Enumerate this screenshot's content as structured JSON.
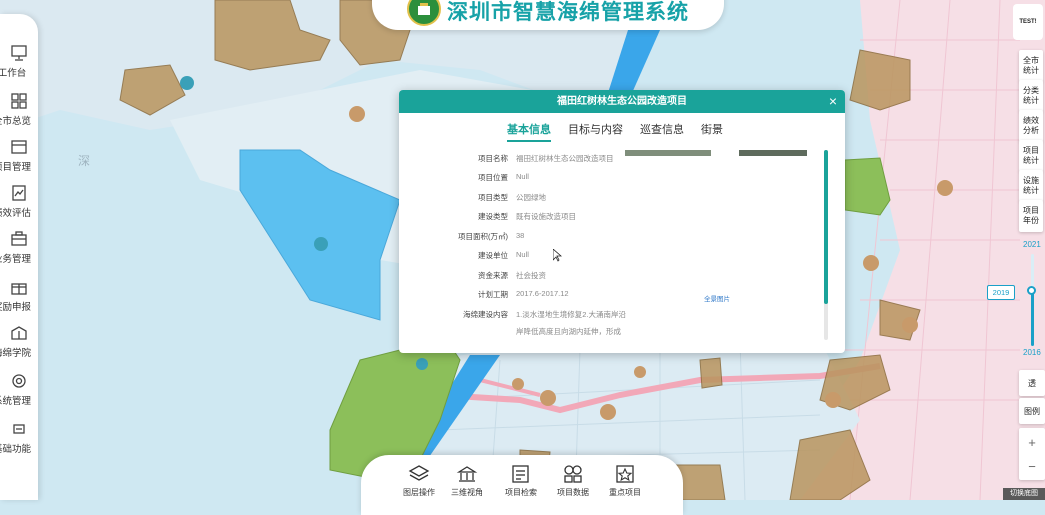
{
  "app": {
    "title": "深圳市智慧海绵管理系统"
  },
  "sidebar": {
    "items": [
      {
        "label": "工作台",
        "icon": "monitor-icon"
      },
      {
        "label": "全市总览",
        "icon": "grid-icon"
      },
      {
        "label": "项目管理",
        "icon": "folder-icon"
      },
      {
        "label": "绩效评估",
        "icon": "chart-icon"
      },
      {
        "label": "业务管理",
        "icon": "briefcase-icon"
      },
      {
        "label": "奖励申报",
        "icon": "gift-icon"
      },
      {
        "label": "海绵学院",
        "icon": "book-icon"
      },
      {
        "label": "系统管理",
        "icon": "gear-icon"
      },
      {
        "label": "基础功能",
        "icon": "box-icon"
      }
    ]
  },
  "right_stats": [
    {
      "label": "全市\n统计"
    },
    {
      "label": "分类\n统计"
    },
    {
      "label": "绩效\n分析"
    },
    {
      "label": "项目\n统计"
    },
    {
      "label": "设施\n统计"
    },
    {
      "label": "项目\n年份"
    }
  ],
  "year_slider": {
    "max": "2021",
    "min": "2016",
    "current": "2019",
    "position": 0.6
  },
  "map_controls": {
    "transparent": "透",
    "legend": "图例",
    "zoom_in": "+",
    "zoom_out": "−"
  },
  "map_labels": [
    {
      "text": "深"
    },
    {
      "text": "TEST!"
    }
  ],
  "panel": {
    "title": "福田红树林生态公园改造项目",
    "close": "×",
    "tabs": [
      "基本信息",
      "目标与内容",
      "巡查信息",
      "街景"
    ],
    "active_tab": 0,
    "rows": [
      {
        "label": "项目名称",
        "value": "福田红树林生态公园改造项目"
      },
      {
        "label": "项目位置",
        "value": "Null"
      },
      {
        "label": "项目类型",
        "value": "公园绿地"
      },
      {
        "label": "建设类型",
        "value": "既有设施改造项目"
      },
      {
        "label": "项目面积(万㎡)",
        "value": "38"
      },
      {
        "label": "建设单位",
        "value": "Null"
      },
      {
        "label": "资金来源",
        "value": "社会投资"
      },
      {
        "label": "计划工期",
        "value": "2017.6-2017.12"
      },
      {
        "label": "海绵建设内容",
        "value": "1.淡水湿地生境修复2.大涌南岸沿"
      },
      {
        "label": "",
        "value": "岸降低高度且向湖内延伸，形成"
      }
    ],
    "all_photos": "全景图片"
  },
  "bottom_bar": {
    "items": [
      {
        "label": "图层操作",
        "icon": "layers-icon"
      },
      {
        "label": "三维视角",
        "icon": "building-icon"
      },
      {
        "label": "项目检索",
        "icon": "list-icon"
      },
      {
        "label": "项目数据",
        "icon": "data-icon"
      },
      {
        "label": "重点项目",
        "icon": "star-icon"
      }
    ]
  },
  "bottom_right": {
    "label": "切换底图"
  },
  "colors": {
    "accent": "#1aa39a",
    "title": "#17a2a8",
    "water": "#cfe8f2",
    "project_fill": "#b9955e",
    "green_fill": "#8cbf5a",
    "blue_fill": "#5cc0f0",
    "pink_zone": "#f6dfe6"
  }
}
